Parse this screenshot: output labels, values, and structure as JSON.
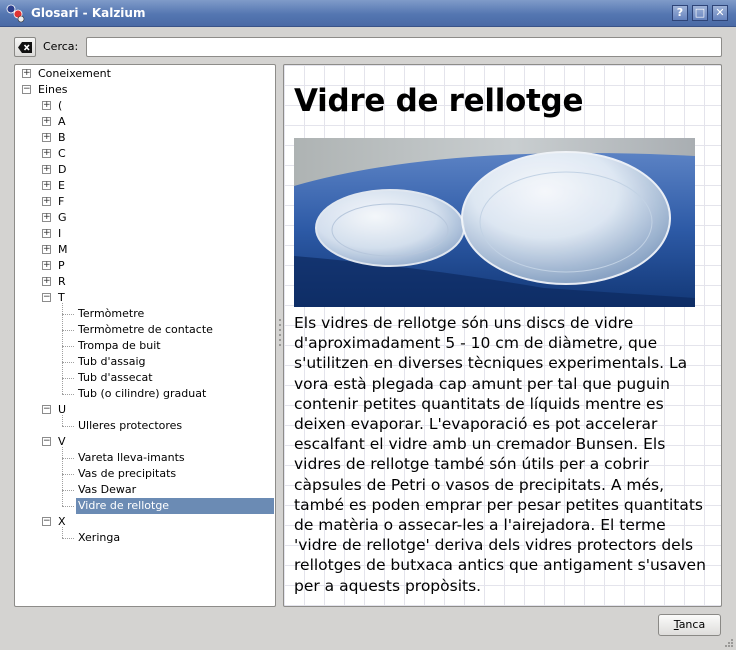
{
  "window": {
    "title": "Glosari - Kalzium",
    "buttons": {
      "help": "?",
      "maximize": "□",
      "close": "✕"
    }
  },
  "search": {
    "label": "Cerca:",
    "value": "",
    "placeholder": ""
  },
  "tree": {
    "root_items": [
      {
        "label": "Coneixement",
        "expanded": false
      },
      {
        "label": "Eines",
        "expanded": true
      }
    ],
    "groups": [
      {
        "label": "(",
        "expanded": false
      },
      {
        "label": "A",
        "expanded": false
      },
      {
        "label": "B",
        "expanded": false
      },
      {
        "label": "C",
        "expanded": false
      },
      {
        "label": "D",
        "expanded": false
      },
      {
        "label": "E",
        "expanded": false
      },
      {
        "label": "F",
        "expanded": false
      },
      {
        "label": "G",
        "expanded": false
      },
      {
        "label": "I",
        "expanded": false
      },
      {
        "label": "M",
        "expanded": false
      },
      {
        "label": "P",
        "expanded": false
      },
      {
        "label": "R",
        "expanded": false
      },
      {
        "label": "T",
        "expanded": true,
        "children": [
          "Termòmetre",
          "Termòmetre de contacte",
          "Trompa de buit",
          "Tub d'assaig",
          "Tub d'assecat",
          "Tub (o cilindre) graduat"
        ]
      },
      {
        "label": "U",
        "expanded": true,
        "children": [
          "Ulleres protectores"
        ]
      },
      {
        "label": "V",
        "expanded": true,
        "children": [
          "Vareta lleva-imants",
          "Vas de precipitats",
          "Vas Dewar",
          "Vidre de rellotge"
        ]
      },
      {
        "label": "X",
        "expanded": true,
        "children": [
          "Xeringa"
        ]
      }
    ],
    "selected": "Vidre de rellotge"
  },
  "article": {
    "title": "Vidre de rellotge",
    "body": "Els vidres de rellotge són uns discs de vidre d'aproximadament 5 - 10 cm de diàmetre, que s'utilitzen en diverses tècniques experimentals. La vora està plegada cap amunt per tal que puguin contenir petites quantitats de líquids mentre es deixen evaporar. L'evaporació es pot accelerar escalfant el vidre amb un cremador Bunsen. Els vidres de rellotge també són útils per a cobrir càpsules de Petri o vasos de precipitats. A més, també es poden emprar per pesar petites quantitats de matèria o assecar-les a l'airejadora. El terme 'vidre de rellotge' deriva dels vidres protectors dels rellotges de butxaca antics que antigament s'usaven per a aquests propòsits."
  },
  "footer": {
    "close_label": "Tanca"
  },
  "colors": {
    "titlebar": "#5476b1",
    "selection": "#6b8bb4",
    "window_bg": "#d4d3d1"
  }
}
